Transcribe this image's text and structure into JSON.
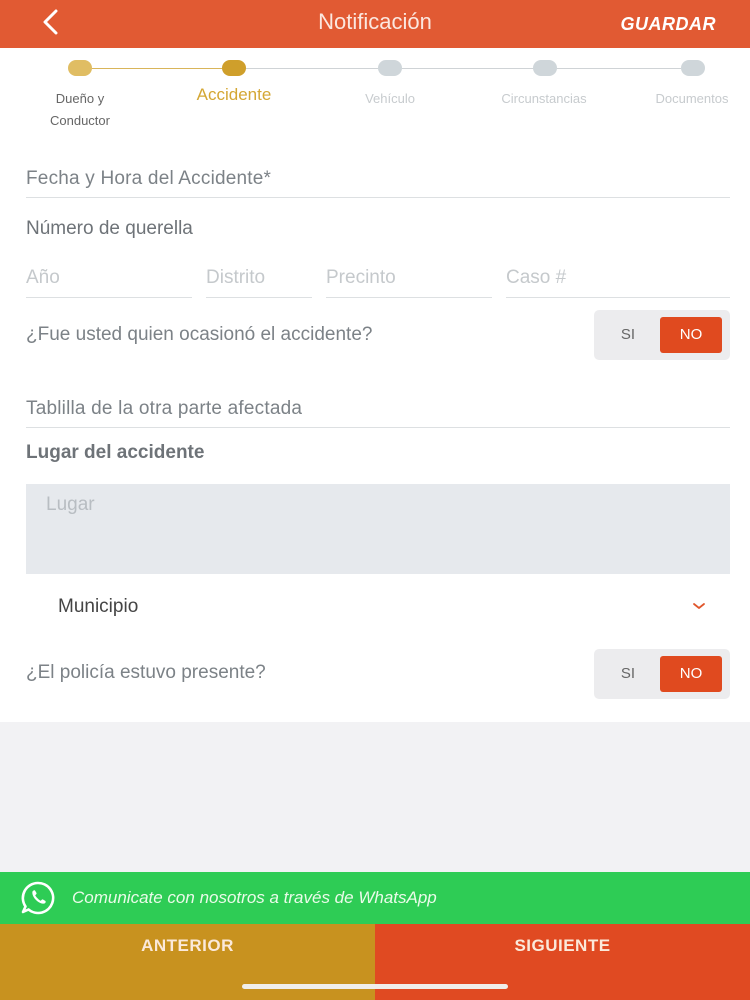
{
  "header": {
    "title": "Notificación",
    "save_label": "GUARDAR",
    "back_icon": "chevron-left-icon"
  },
  "colors": {
    "brand": "#e15a33",
    "step_done": "#e0bd63",
    "step_active": "#cf9f2b",
    "whatsapp": "#2ecc55",
    "prev": "#c8921f",
    "next": "#e04a22"
  },
  "stepper": {
    "steps": [
      {
        "label": "Dueño y\nConductor",
        "state": "done"
      },
      {
        "label": "Accidente",
        "state": "active"
      },
      {
        "label": "Vehículo",
        "state": "pending"
      },
      {
        "label": "Circunstancias",
        "state": "pending"
      },
      {
        "label": "Documentos",
        "state": "pending"
      }
    ]
  },
  "form": {
    "fecha_label": "Fecha y Hora del Accidente*",
    "querella_label": "Número de querella",
    "querella_fields": {
      "anio": "Año",
      "distrito": "Distrito",
      "precinto": "Precinto",
      "caso": "Caso #"
    },
    "ocasiono_question": "¿Fue usted quien ocasionó el accidente?",
    "ocasiono_toggle": {
      "si": "SI",
      "no": "NO",
      "selected": "NO"
    },
    "tablilla_label": "Tablilla de la otra parte afectada",
    "lugar_heading": "Lugar del accidente",
    "lugar_placeholder": "Lugar",
    "municipio_label": "Municipio",
    "policia_question": "¿El policía estuvo presente?",
    "policia_toggle": {
      "si": "SI",
      "no": "NO",
      "selected": "NO"
    }
  },
  "whatsapp": {
    "text": "Comunicate con nosotros a través de WhatsApp",
    "icon": "whatsapp-icon"
  },
  "footer": {
    "prev_label": "ANTERIOR",
    "next_label": "SIGUIENTE"
  }
}
